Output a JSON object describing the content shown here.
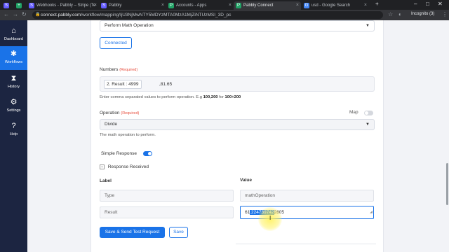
{
  "browser": {
    "tabs": [
      {
        "label": "Webhooks - Pabbly – Stripe (Te",
        "icon_letter": "S",
        "icon_color": "#635bff"
      },
      {
        "label": "Pabbly",
        "icon_letter": "S",
        "icon_color": "#635bff"
      },
      {
        "label": "Accounts - Apps",
        "icon_letter": "P",
        "icon_color": "#21a366"
      },
      {
        "label": "Pabbly Connect",
        "icon_letter": "P",
        "icon_color": "#21a366"
      },
      {
        "label": "usd - Google Search",
        "icon_letter": "G",
        "icon_color": "#4285f4"
      }
    ],
    "url_host": "connect.pabbly.com",
    "url_path": "/workflow/mapping/IjU3NjMwNTY5MDYzMTA0MzA1MjZiNTUzMSI_3D_pc",
    "incognito_label": "Incognito (3)"
  },
  "sidebar": {
    "items": [
      {
        "label": "Dashboard",
        "icon": "dashboard-icon",
        "glyph": "⌂"
      },
      {
        "label": "Workflows",
        "icon": "workflow-icon",
        "glyph": "✱"
      },
      {
        "label": "History",
        "icon": "history-icon",
        "glyph": "⧗"
      },
      {
        "label": "Settings",
        "icon": "gear-icon",
        "glyph": "⚙"
      },
      {
        "label": "Help",
        "icon": "help-icon",
        "glyph": "?"
      }
    ]
  },
  "form": {
    "action_select": "Perform Math Operation",
    "connected_label": "Connected",
    "numbers_label": "Numbers",
    "required_text": "(Required)",
    "numbers_chip": "2. Result : 4999",
    "numbers_after_chip": ",81.65",
    "numbers_hint_prefix": "Enter comma separated values to perform operation. E.g ",
    "numbers_hint_ex1": "100,200",
    "numbers_hint_mid": " for ",
    "numbers_hint_ex2": "100+200",
    "operation_label": "Operation",
    "map_label": "Map",
    "operation_select": "Divide",
    "operation_hint": "The math operation to perform.",
    "simple_response_label": "Simple Response",
    "response_received_label": "Response Received",
    "col_label": "Label",
    "col_value": "Value",
    "rows": [
      {
        "label": "Type",
        "value": "mathOperation"
      },
      {
        "label": "Result",
        "value_prefix": "61",
        "value_selected": ".224739742",
        "value_suffix": "2805"
      }
    ],
    "save_send_label": "Save & Send Test Request",
    "save_label": "Save"
  },
  "colors": {
    "accent": "#1a73e8",
    "sidebar_bg": "#1c2541",
    "required": "#e74c3c"
  }
}
